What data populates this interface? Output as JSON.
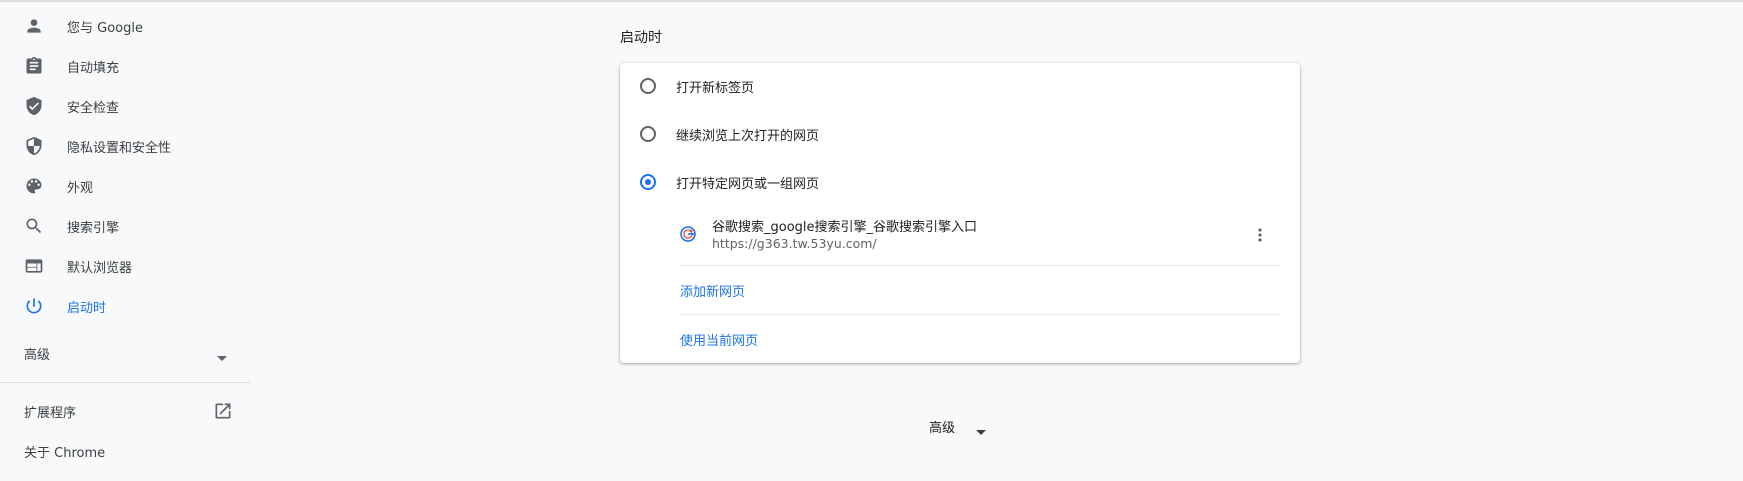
{
  "colors": {
    "accent": "#1a73e8",
    "text": "#202124",
    "secondary_text": "#5f6368",
    "background": "#f8f9fa",
    "card": "#ffffff"
  },
  "sidebar": {
    "items": [
      {
        "label": "您与 Google",
        "icon": "person-icon"
      },
      {
        "label": "自动填充",
        "icon": "clipboard-icon"
      },
      {
        "label": "安全检查",
        "icon": "shield-check-icon"
      },
      {
        "label": "隐私设置和安全性",
        "icon": "shield-half-icon"
      },
      {
        "label": "外观",
        "icon": "palette-icon"
      },
      {
        "label": "搜索引擎",
        "icon": "search-icon"
      },
      {
        "label": "默认浏览器",
        "icon": "browser-window-icon"
      },
      {
        "label": "启动时",
        "icon": "power-icon",
        "active": true
      }
    ],
    "advanced_label": "高级",
    "extensions_label": "扩展程序",
    "about_label": "关于 Chrome"
  },
  "startup": {
    "section_title": "启动时",
    "options": [
      {
        "label": "打开新标签页",
        "checked": false
      },
      {
        "label": "继续浏览上次打开的网页",
        "checked": false
      },
      {
        "label": "打开特定网页或一组网页",
        "checked": true
      }
    ],
    "pages": [
      {
        "title": "谷歌搜索_google搜索引擎_谷歌搜索引擎入口",
        "url": "https://g363.tw.53yu.com/",
        "favicon": "360-favicon-icon"
      }
    ],
    "add_page_label": "添加新网页",
    "use_current_label": "使用当前网页"
  },
  "footer": {
    "advanced_label": "高级"
  }
}
